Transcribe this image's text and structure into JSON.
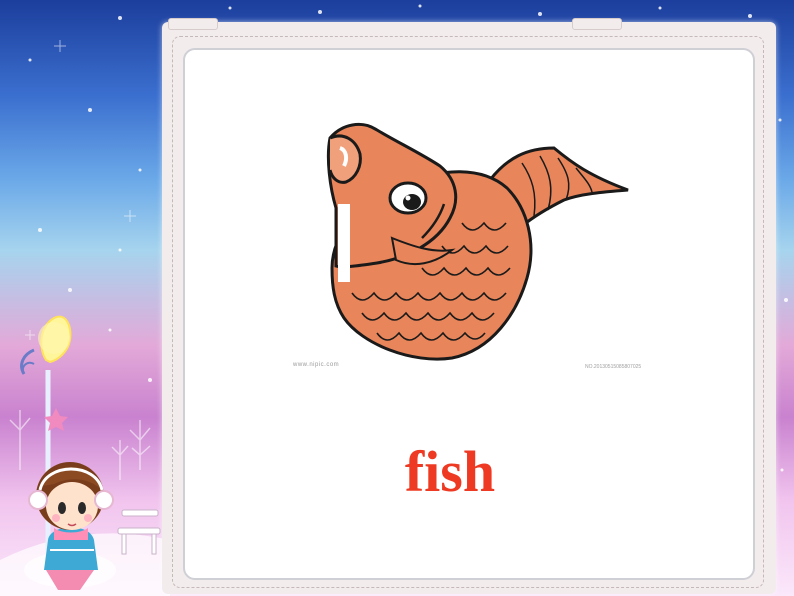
{
  "slide": {
    "word": "fish",
    "watermark_left": "www.nipic.com",
    "watermark_right": "NO.20130515085807025"
  },
  "images": {
    "main_picture": "cartoon-orange-fish",
    "decoration": "cartoon-girl-with-earmuffs-lamp-post-bench"
  },
  "colors": {
    "word": "#ee3a22",
    "fish_body": "#e8855a",
    "fish_outline": "#1a1a1a",
    "card": "#ffffff",
    "frame": "#f2ecec"
  }
}
